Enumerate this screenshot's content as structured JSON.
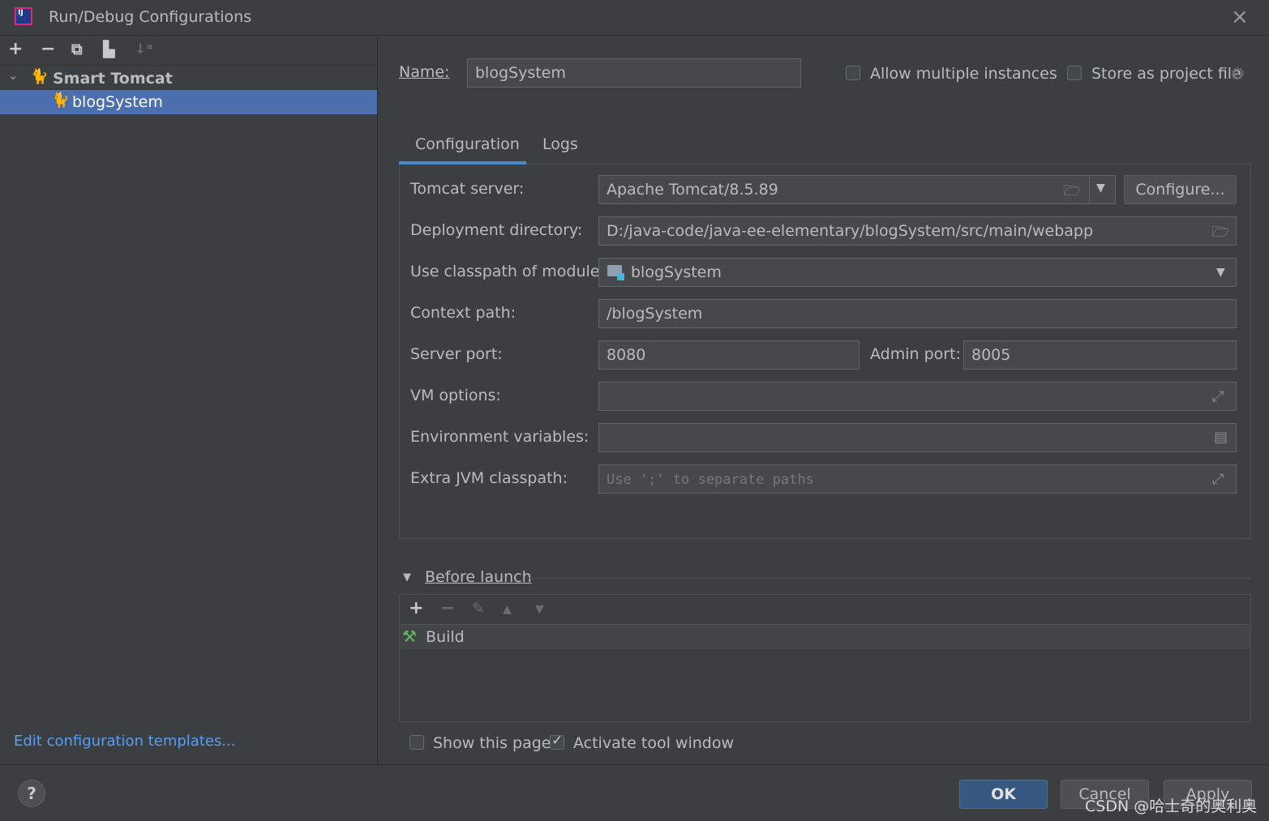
{
  "window": {
    "title": "Run/Debug Configurations",
    "app_logo_text": "IJ"
  },
  "left": {
    "toolbar": [
      "add-icon",
      "remove-icon",
      "copy-icon",
      "folder-add-icon",
      "sort-icon"
    ],
    "tree": {
      "root": "Smart Tomcat",
      "child": "blogSystem"
    },
    "edit_templates_link": "Edit configuration templates..."
  },
  "header": {
    "name_label": "Name:",
    "name_value": "blogSystem",
    "allow_multiple": {
      "label": "Allow multiple instances",
      "checked": false
    },
    "store_project": {
      "label": "Store as project file",
      "checked": false
    }
  },
  "tabs": [
    {
      "label": "Configuration",
      "active": true
    },
    {
      "label": "Logs",
      "active": false
    }
  ],
  "config": {
    "tomcat_server": {
      "label": "Tomcat server:",
      "value": "Apache Tomcat/8.5.89",
      "button": "Configure..."
    },
    "deployment_dir": {
      "label": "Deployment directory:",
      "value": "D:/java-code/java-ee-elementary/blogSystem/src/main/webapp"
    },
    "classpath_module": {
      "label": "Use classpath of module:",
      "value": "blogSystem"
    },
    "context_path": {
      "label": "Context path:",
      "value": "/blogSystem"
    },
    "server_port": {
      "label": "Server port:",
      "value": "8080"
    },
    "admin_port": {
      "label": "Admin port:",
      "value": "8005"
    },
    "vm_options": {
      "label": "VM options:",
      "value": ""
    },
    "env_vars": {
      "label": "Environment variables:",
      "value": ""
    },
    "extra_jvm": {
      "label": "Extra JVM classpath:",
      "placeholder": "Use ';' to separate paths"
    }
  },
  "before_launch": {
    "title": "Before launch",
    "items": [
      "Build"
    ]
  },
  "footer": {
    "show_page": {
      "label": "Show this page",
      "checked": false
    },
    "activate_tool": {
      "label": "Activate tool window",
      "checked": true
    },
    "ok": "OK",
    "cancel": "Cancel",
    "apply": "Apply",
    "help": "?",
    "watermark": "CSDN @哈士奇的奥利奥"
  },
  "colors": {
    "accent": "#4b6eaf",
    "ok_button": "#365880",
    "link": "#589df6",
    "tab_underline": "#4a88c7"
  }
}
